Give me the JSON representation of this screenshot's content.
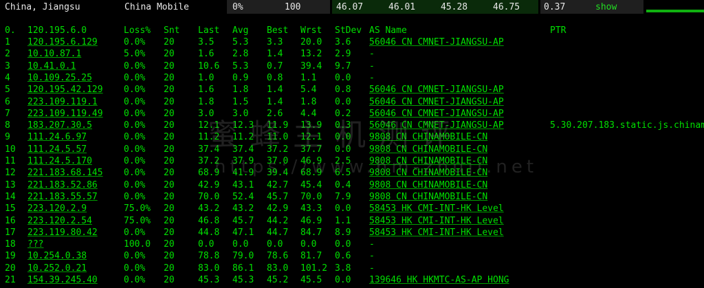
{
  "summary": {
    "location": "China, Jiangsu",
    "isp": "China Mobile",
    "loss": "0%",
    "sent": "100",
    "last": "46.07",
    "avg": "46.01",
    "best": "45.28",
    "worst": "46.75",
    "stdev": "0.37",
    "show_label": "show"
  },
  "columns": [
    "Loss%",
    "Snt",
    "Last",
    "Avg",
    "Best",
    "Wrst",
    "StDev",
    "AS Name",
    "PTR"
  ],
  "header_first": {
    "idx": "0.",
    "host": "120.195.6.0"
  },
  "rows": [
    {
      "idx": "1",
      "host": "120.195.6.129",
      "loss": "0.0%",
      "snt": "20",
      "last": "3.5",
      "avg": "5.3",
      "best": "3.3",
      "wrst": "20.0",
      "stdev": "3.6",
      "as": "56046 CN CMNET-JIANGSU-AP",
      "ptr": ""
    },
    {
      "idx": "2",
      "host": "10.10.87.1",
      "loss": "5.0%",
      "snt": "20",
      "last": "1.6",
      "avg": "2.8",
      "best": "1.4",
      "wrst": "13.2",
      "stdev": "2.9",
      "as": "-",
      "ptr": ""
    },
    {
      "idx": "3",
      "host": "10.41.0.1",
      "loss": "0.0%",
      "snt": "20",
      "last": "10.6",
      "avg": "5.3",
      "best": "0.7",
      "wrst": "39.4",
      "stdev": "9.7",
      "as": "-",
      "ptr": ""
    },
    {
      "idx": "4",
      "host": "10.109.25.25",
      "loss": "0.0%",
      "snt": "20",
      "last": "1.0",
      "avg": "0.9",
      "best": "0.8",
      "wrst": "1.1",
      "stdev": "0.0",
      "as": "-",
      "ptr": ""
    },
    {
      "idx": "5",
      "host": "120.195.42.129",
      "loss": "0.0%",
      "snt": "20",
      "last": "1.6",
      "avg": "1.8",
      "best": "1.4",
      "wrst": "5.4",
      "stdev": "0.8",
      "as": "56046 CN CMNET-JIANGSU-AP",
      "ptr": ""
    },
    {
      "idx": "6",
      "host": "223.109.119.1",
      "loss": "0.0%",
      "snt": "20",
      "last": "1.8",
      "avg": "1.5",
      "best": "1.4",
      "wrst": "1.8",
      "stdev": "0.0",
      "as": "56046 CN CMNET-JIANGSU-AP",
      "ptr": ""
    },
    {
      "idx": "7",
      "host": "223.109.119.49",
      "loss": "0.0%",
      "snt": "20",
      "last": "3.0",
      "avg": "3.0",
      "best": "2.6",
      "wrst": "4.4",
      "stdev": "0.2",
      "as": "56046 CN CMNET-JIANGSU-AP",
      "ptr": ""
    },
    {
      "idx": "8",
      "host": "183.207.30.5",
      "loss": "0.0%",
      "snt": "20",
      "last": "12.1",
      "avg": "12.3",
      "best": "11.9",
      "wrst": "13.9",
      "stdev": "0.3",
      "as": "56046 CN CMNET-JIANGSU-AP",
      "ptr": "5.30.207.183.static.js.chinam..."
    },
    {
      "idx": "9",
      "host": "111.24.6.97",
      "loss": "0.0%",
      "snt": "20",
      "last": "11.2",
      "avg": "11.2",
      "best": "11.0",
      "wrst": "12.1",
      "stdev": "0.0",
      "as": "9808 CN CHINAMOBILE-CN",
      "ptr": ""
    },
    {
      "idx": "10",
      "host": "111.24.5.57",
      "loss": "0.0%",
      "snt": "20",
      "last": "37.4",
      "avg": "37.4",
      "best": "37.2",
      "wrst": "37.7",
      "stdev": "0.0",
      "as": "9808 CN CHINAMOBILE-CN",
      "ptr": ""
    },
    {
      "idx": "11",
      "host": "111.24.5.170",
      "loss": "0.0%",
      "snt": "20",
      "last": "37.2",
      "avg": "37.9",
      "best": "37.0",
      "wrst": "46.9",
      "stdev": "2.5",
      "as": "9808 CN CHINAMOBILE-CN",
      "ptr": ""
    },
    {
      "idx": "12",
      "host": "221.183.68.145",
      "loss": "0.0%",
      "snt": "20",
      "last": "68.9",
      "avg": "41.9",
      "best": "39.4",
      "wrst": "68.9",
      "stdev": "6.5",
      "as": "9808 CN CHINAMOBILE-CN",
      "ptr": ""
    },
    {
      "idx": "13",
      "host": "221.183.52.86",
      "loss": "0.0%",
      "snt": "20",
      "last": "42.9",
      "avg": "43.1",
      "best": "42.7",
      "wrst": "45.4",
      "stdev": "0.4",
      "as": "9808 CN CHINAMOBILE-CN",
      "ptr": ""
    },
    {
      "idx": "14",
      "host": "221.183.55.57",
      "loss": "0.0%",
      "snt": "20",
      "last": "70.0",
      "avg": "52.4",
      "best": "45.7",
      "wrst": "70.0",
      "stdev": "7.9",
      "as": "9808 CN CHINAMOBILE-CN",
      "ptr": ""
    },
    {
      "idx": "15",
      "host": "223.120.2.9",
      "loss": "75.0%",
      "snt": "20",
      "last": "43.2",
      "avg": "43.2",
      "best": "42.9",
      "wrst": "43.3",
      "stdev": "0.0",
      "as": "58453 HK CMI-INT-HK Level",
      "ptr": ""
    },
    {
      "idx": "16",
      "host": "223.120.2.54",
      "loss": "75.0%",
      "snt": "20",
      "last": "46.8",
      "avg": "45.7",
      "best": "44.2",
      "wrst": "46.9",
      "stdev": "1.1",
      "as": "58453 HK CMI-INT-HK Level",
      "ptr": ""
    },
    {
      "idx": "17",
      "host": "223.119.80.42",
      "loss": "0.0%",
      "snt": "20",
      "last": "44.8",
      "avg": "47.1",
      "best": "44.7",
      "wrst": "84.7",
      "stdev": "8.9",
      "as": "58453 HK CMI-INT-HK Level",
      "ptr": ""
    },
    {
      "idx": "18",
      "host": "???",
      "loss": "100.0",
      "snt": "20",
      "last": "0.0",
      "avg": "0.0",
      "best": "0.0",
      "wrst": "0.0",
      "stdev": "0.0",
      "as": "-",
      "ptr": ""
    },
    {
      "idx": "19",
      "host": "10.254.0.38",
      "loss": "0.0%",
      "snt": "20",
      "last": "78.8",
      "avg": "79.0",
      "best": "78.6",
      "wrst": "81.7",
      "stdev": "0.6",
      "as": "-",
      "ptr": ""
    },
    {
      "idx": "20",
      "host": "10.252.0.21",
      "loss": "0.0%",
      "snt": "20",
      "last": "83.0",
      "avg": "86.1",
      "best": "83.0",
      "wrst": "101.2",
      "stdev": "3.8",
      "as": "-",
      "ptr": ""
    },
    {
      "idx": "21",
      "host": "154.39.245.40",
      "loss": "0.0%",
      "snt": "20",
      "last": "45.3",
      "avg": "45.3",
      "best": "45.2",
      "wrst": "45.5",
      "stdev": "0.0",
      "as": "139646 HK HKMTC-AS-AP HONG",
      "ptr": ""
    }
  ],
  "watermark": {
    "line1": "蜜蜂主机测评",
    "line2": "https://www.hm-zhuji.net"
  }
}
